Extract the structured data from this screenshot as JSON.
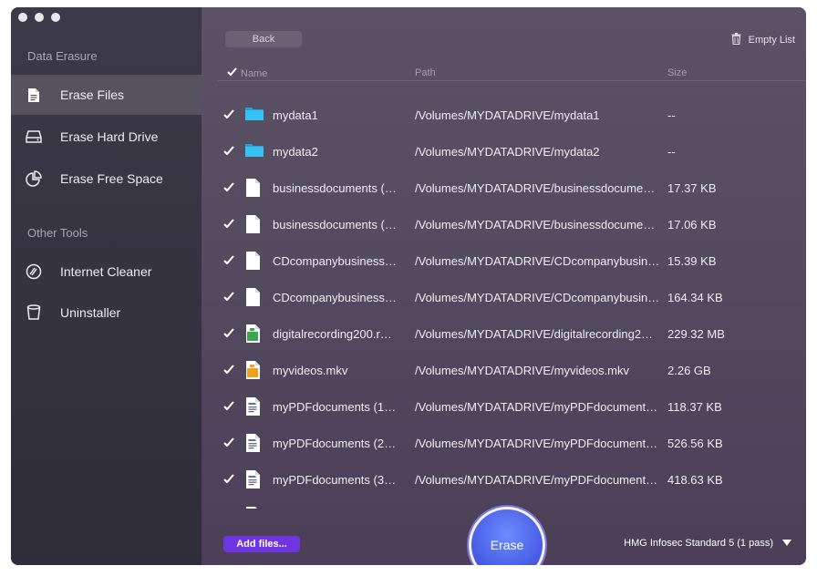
{
  "sidebar": {
    "section1": "Data Erasure",
    "items": [
      {
        "label": "Erase Files",
        "icon": "document-icon"
      },
      {
        "label": "Erase Hard Drive",
        "icon": "hard-drive-icon"
      },
      {
        "label": "Erase Free Space",
        "icon": "pie-chart-icon"
      }
    ],
    "section2": "Other Tools",
    "tools": [
      {
        "label": "Internet Cleaner",
        "icon": "internet-cleaner-icon"
      },
      {
        "label": "Uninstaller",
        "icon": "trash-bin-icon"
      }
    ]
  },
  "toolbar": {
    "back_label": "Back",
    "empty_list_label": "Empty List"
  },
  "columns": {
    "name": "Name",
    "path": "Path",
    "size": "Size"
  },
  "rows": [
    {
      "name": "mydata1",
      "path": "/Volumes/MYDATADRIVE/mydata1",
      "size": "--",
      "type": "folder",
      "checked": true
    },
    {
      "name": "mydata2",
      "path": "/Volumes/MYDATADRIVE/mydata2",
      "size": "--",
      "type": "folder",
      "checked": true
    },
    {
      "name": "businessdocuments (…",
      "path": "/Volumes/MYDATADRIVE/businessdocume…",
      "size": "17.37 KB",
      "type": "document",
      "checked": true
    },
    {
      "name": "businessdocuments (…",
      "path": "/Volumes/MYDATADRIVE/businessdocume…",
      "size": "17.06 KB",
      "type": "document",
      "checked": true
    },
    {
      "name": "CDcompanybusiness…",
      "path": "/Volumes/MYDATADRIVE/CDcompanybusin…",
      "size": "15.39 KB",
      "type": "document",
      "checked": true
    },
    {
      "name": "CDcompanybusiness…",
      "path": "/Volumes/MYDATADRIVE/CDcompanybusin…",
      "size": "164.34 KB",
      "type": "document",
      "checked": true
    },
    {
      "name": "digitalrecording200.r…",
      "path": "/Volumes/MYDATADRIVE/digitalrecording2…",
      "size": "229.32 MB",
      "type": "audio",
      "checked": true
    },
    {
      "name": "myvideos.mkv",
      "path": "/Volumes/MYDATADRIVE/myvideos.mkv",
      "size": "2.26 GB",
      "type": "video",
      "checked": true
    },
    {
      "name": "myPDFdocuments (1…",
      "path": "/Volumes/MYDATADRIVE/myPDFdocument…",
      "size": "118.37 KB",
      "type": "pdf",
      "checked": true
    },
    {
      "name": "myPDFdocuments (2…",
      "path": "/Volumes/MYDATADRIVE/myPDFdocument…",
      "size": "526.56 KB",
      "type": "pdf",
      "checked": true
    },
    {
      "name": "myPDFdocuments (3…",
      "path": "/Volumes/MYDATADRIVE/myPDFdocument…",
      "size": "418.63 KB",
      "type": "pdf",
      "checked": true
    },
    {
      "name": "",
      "path": "",
      "size": "",
      "type": "pdf",
      "checked": true
    }
  ],
  "footer": {
    "add_files_label": "Add files...",
    "erase_label": "Erase",
    "method_label": "HMG Infosec Standard 5 (1 pass)"
  },
  "colors": {
    "accent_purple": "#6f35e0",
    "erase_blue": "#4a5fe6",
    "folder_blue": "#2fb8f0"
  }
}
